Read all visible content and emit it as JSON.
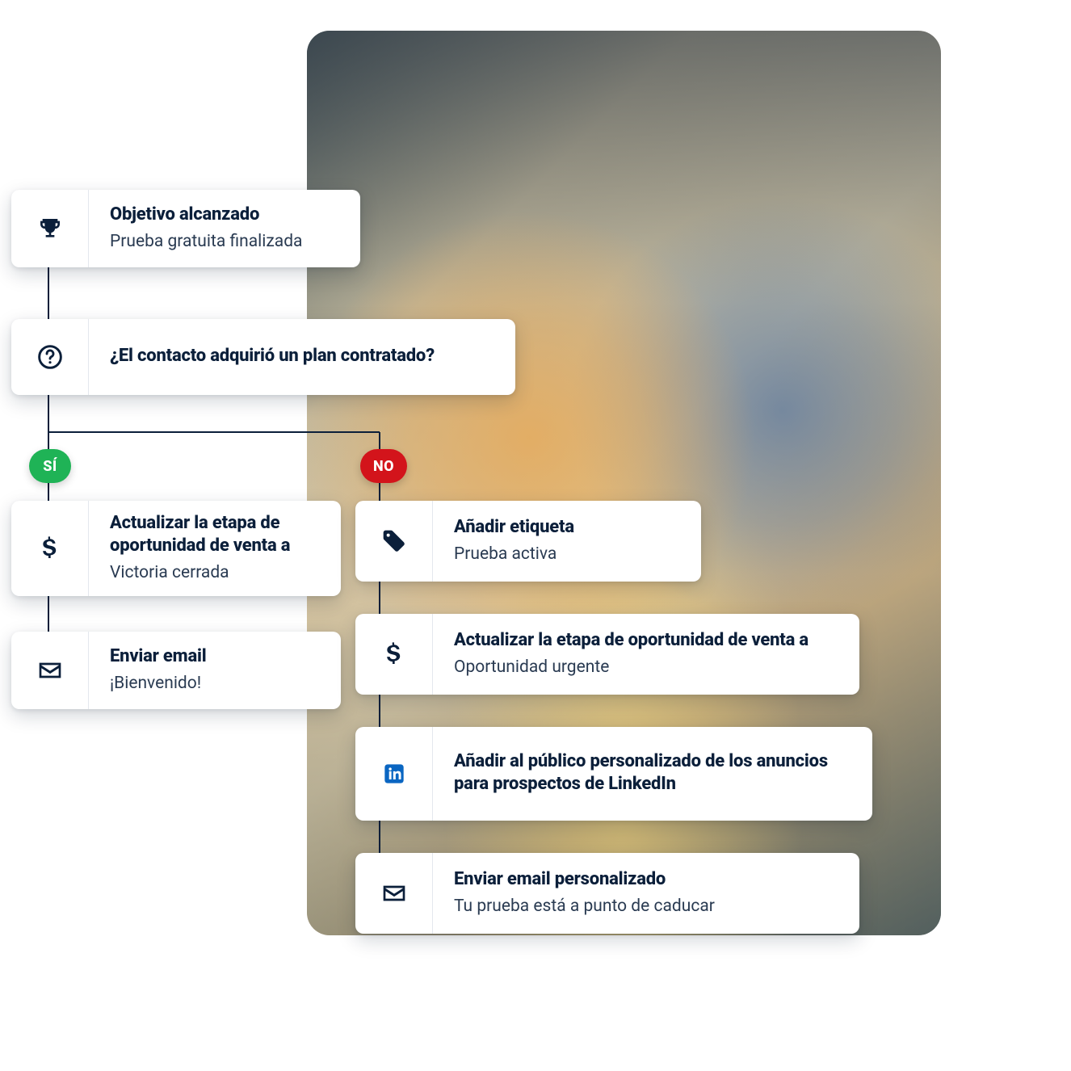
{
  "trigger": {
    "title": "Objetivo alcanzado",
    "sub": "Prueba gratuita finalizada",
    "icon": "trophy-icon"
  },
  "decision": {
    "title": "¿El contacto adquirió un plan contratado?",
    "icon": "question-icon"
  },
  "labels": {
    "yes": "SÍ",
    "no": "NO"
  },
  "yes_branch": [
    {
      "title": "Actualizar la etapa de oportunidad de venta a",
      "sub": "Victoria cerrada",
      "icon": "dollar-icon"
    },
    {
      "title": "Enviar email",
      "sub": "¡Bienvenido!",
      "icon": "envelope-icon"
    }
  ],
  "no_branch": [
    {
      "title": "Añadir etiqueta",
      "sub": "Prueba activa",
      "icon": "tag-icon"
    },
    {
      "title": "Actualizar la etapa de oportunidad de venta a",
      "sub": "Oportunidad urgente",
      "icon": "dollar-icon"
    },
    {
      "title": "Añadir al público personalizado de los anuncios para prospectos de LinkedIn",
      "sub": "",
      "icon": "linkedin-icon"
    },
    {
      "title": "Enviar email personalizado",
      "sub": "Tu prueba está a punto de caducar",
      "icon": "envelope-icon"
    }
  ],
  "colors": {
    "text": "#0b1f3a",
    "yes": "#1fb356",
    "no": "#d3141b",
    "linkedin": "#0a66c2"
  }
}
